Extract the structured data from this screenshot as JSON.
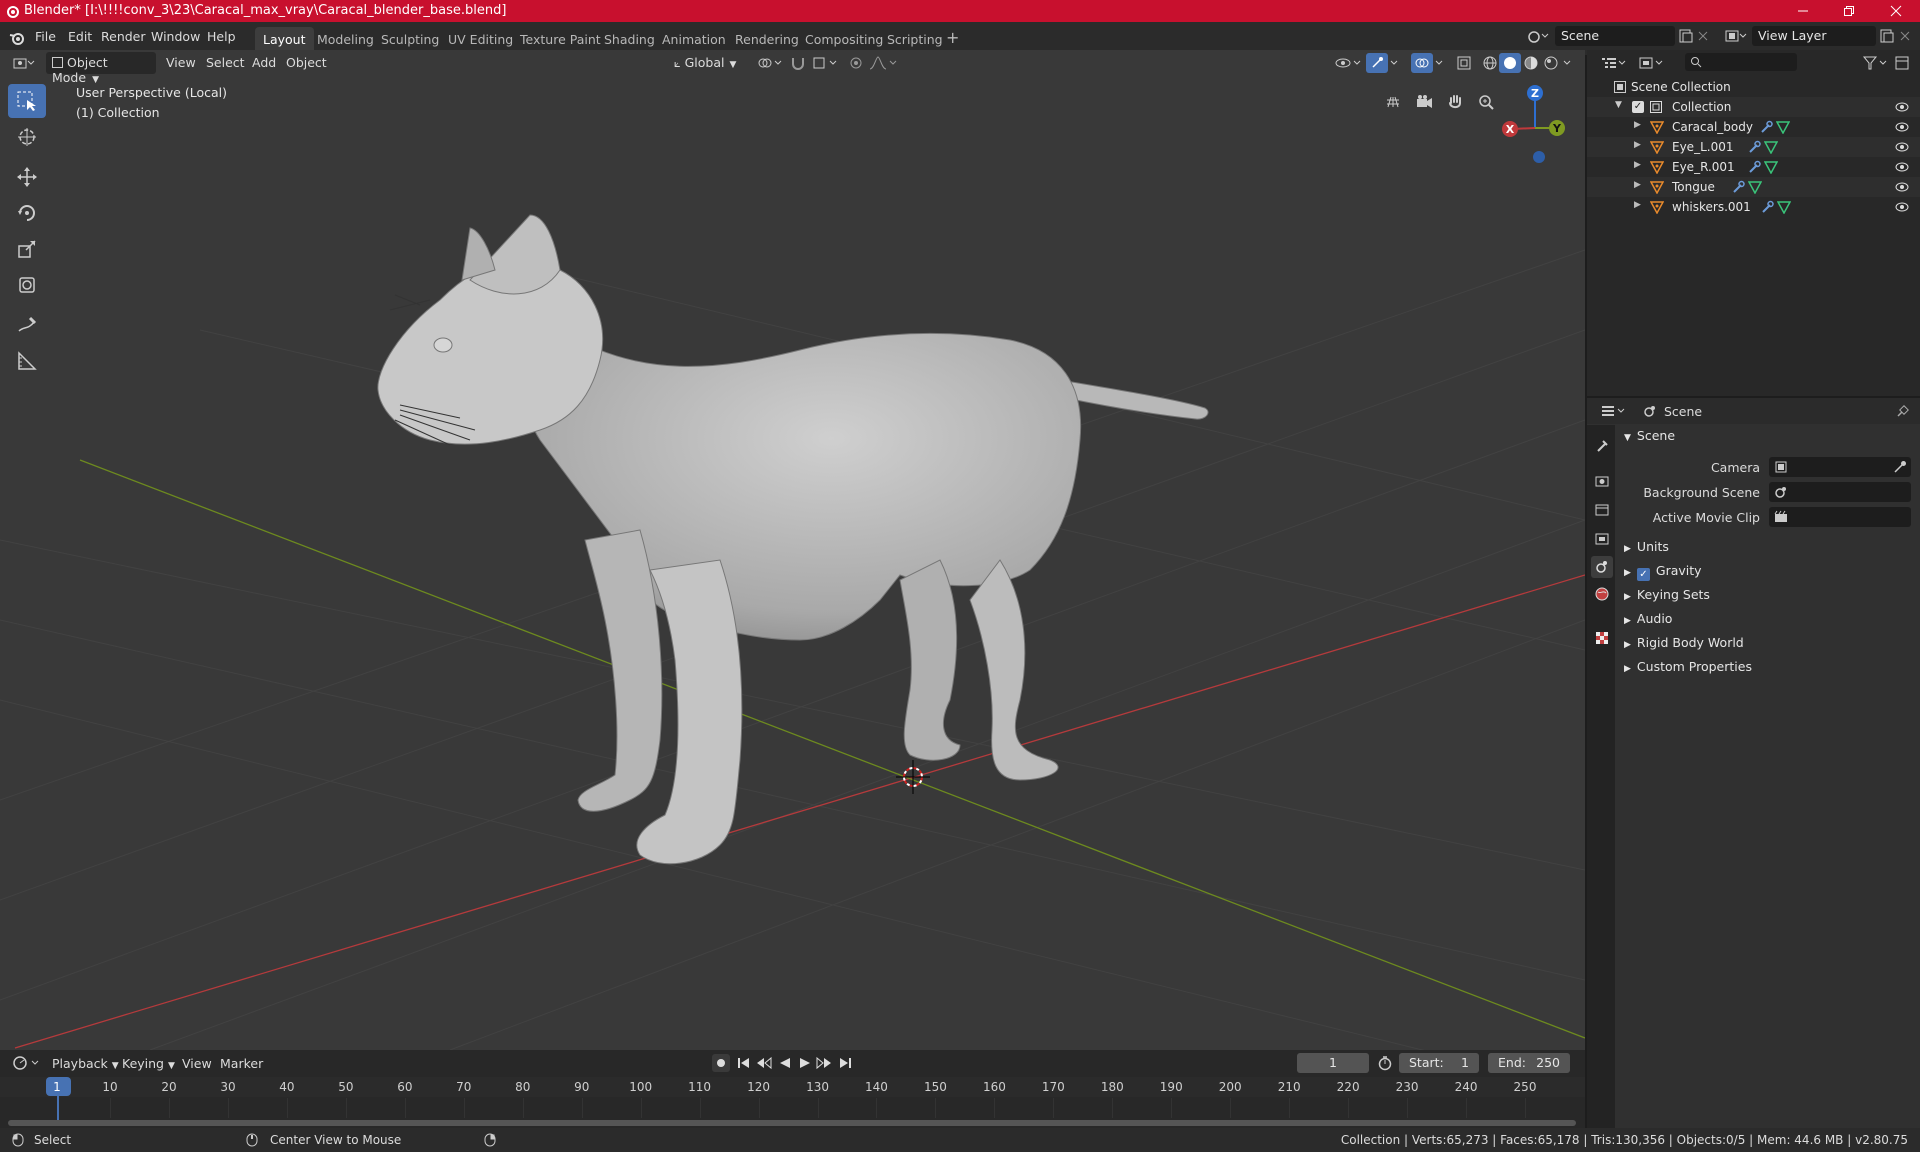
{
  "window": {
    "title": "Blender* [I:\\!!!!conv_3\\23\\Caracal_max_vray\\Caracal_blender_base.blend]"
  },
  "menu": [
    "File",
    "Edit",
    "Render",
    "Window",
    "Help"
  ],
  "workspaces": [
    "Layout",
    "Modeling",
    "Sculpting",
    "UV Editing",
    "Texture Paint",
    "Shading",
    "Animation",
    "Rendering",
    "Compositing",
    "Scripting"
  ],
  "scene_field": "Scene",
  "view_layer_field": "View Layer",
  "viewport_header": {
    "mode": "Object Mode",
    "menus": [
      "View",
      "Select",
      "Add",
      "Object"
    ],
    "orientation": "Global"
  },
  "viewport": {
    "perspective": "User Perspective (Local)",
    "collection": "(1) Collection"
  },
  "gizmo": {
    "x": "X",
    "y": "Y",
    "z": "Z"
  },
  "outliner": {
    "root": "Scene Collection",
    "collection": "Collection",
    "items": [
      "Caracal_body",
      "Eye_L.001",
      "Eye_R.001",
      "Tongue",
      "whiskers.001"
    ]
  },
  "properties": {
    "context": "Scene",
    "panel": "Scene",
    "fields": [
      "Camera",
      "Background Scene",
      "Active Movie Clip"
    ],
    "sections": [
      "Units",
      "Gravity",
      "Keying Sets",
      "Audio",
      "Rigid Body World",
      "Custom Properties"
    ],
    "gravity_checked": true
  },
  "timeline": {
    "menus": [
      "Playback",
      "Keying",
      "View",
      "Marker"
    ],
    "current_frame": "1",
    "start_label": "Start:",
    "start": "1",
    "end_label": "End:",
    "end": "250",
    "ticks": [
      "1",
      "10",
      "20",
      "30",
      "40",
      "50",
      "60",
      "70",
      "80",
      "90",
      "100",
      "110",
      "120",
      "130",
      "140",
      "150",
      "160",
      "170",
      "180",
      "190",
      "200",
      "210",
      "220",
      "230",
      "240",
      "250"
    ]
  },
  "status": {
    "left": "Select",
    "middle": "Center View to Mouse",
    "right": "Collection | Verts:65,273 | Faces:65,178 | Tris:130,356 | Objects:0/5 | Mem: 44.6 MB | v2.80.75"
  },
  "colors": {
    "accent": "#4772b3",
    "title_bar": "#c8102e",
    "x_axis": "#c0393b",
    "y_axis": "#7f9a22",
    "z_axis": "#2d6fd1"
  }
}
